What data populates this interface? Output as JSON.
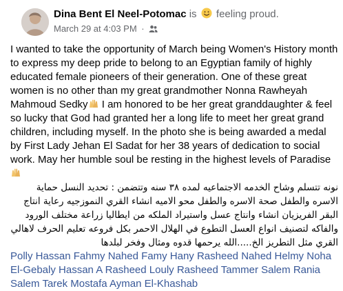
{
  "post": {
    "author": "Dina Bent El Neel-Potomac",
    "is_text": "is",
    "feeling_text": "feeling proud.",
    "feeling_icon": "smiling-face-emoji",
    "timestamp": "March 29 at 4:03 PM",
    "separator": "·",
    "audience_icon": "friends-icon",
    "body_ltr": "I wanted to take the opportunity of March being Women's History month to express my deep pride to belong to an Egyptian family of highly educated female pioneers of their generation. One of these great women is no other than my great grandmother Nonna Rawheyah Mahmoud Sedky",
    "body_ltr_2": " I am honored to be her great granddaughter & feel so lucky that God had granted her a long life to meet her great grand children, including myself. In the photo she is being awarded a medal by First Lady Jehan El Sadat for her 38 years of dedication to social work. May her humble soul be resting in the highest levels of Paradise",
    "hands_icon": "raising-hands-emoji",
    "body_rtl": "نونه تتسلم وشاح الخدمه الاجتماعيه لمده ٣٨ سنه وتتضمن : تحديد النسل حماية الاسره والطفل صحة الاسره والطفل محو الاميه انشاء القري النموزجيه رعاية انتاج البقر الفريزيان انشاء وانتاج عسل واستيراد الملكه من ايطاليا زراعة مختلف الورود والفاكه لتصنيف انواع العسل التطوع في الهلال الاحمر بكل فروعه تعليم الحرف لاهالي القري مثل التطريز الخ.....الله يرحمها قدوه ومثال وفخر لبلدها",
    "tagged": [
      "Polly Hassan",
      "Fahmy Nahed",
      "Famy",
      "Hany Rasheed",
      "Nahed Helmy",
      "Noha El-Gebaly",
      "Hassan A Rasheed",
      "Louly Rasheed",
      "Tammer Salem",
      "Rania Salem",
      "Tarek Mostafa",
      "Ayman El-Khashab"
    ]
  },
  "colors": {
    "text": "#050505",
    "muted": "#65676b",
    "link": "#385898"
  }
}
